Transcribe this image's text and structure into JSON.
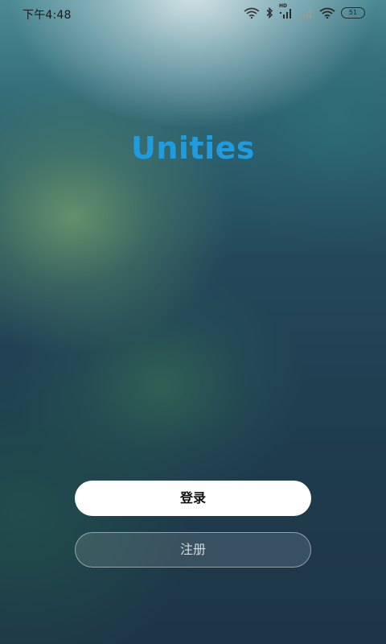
{
  "status_bar": {
    "time": "下午4:48",
    "hd": "HD",
    "battery": "51",
    "icons": [
      "wifi-icon",
      "bluetooth-icon",
      "signal-icon",
      "signal-weak-icon",
      "wifi-icon",
      "battery-icon"
    ]
  },
  "app": {
    "logo_text": "Unities"
  },
  "actions": {
    "login_label": "登录",
    "register_label": "注册"
  },
  "colors": {
    "logo": "#1f9ce0",
    "login_button_bg": "#ffffff",
    "register_button_border": "rgba(255,255,255,0.45)"
  }
}
